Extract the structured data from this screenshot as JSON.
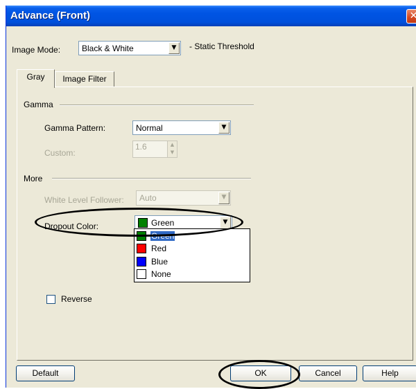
{
  "window": {
    "title": "Advance (Front)",
    "close_glyph": "✕"
  },
  "image_mode": {
    "label": "Image Mode:",
    "value": "Black & White",
    "note": "- Static Threshold"
  },
  "tabs": [
    {
      "label": "Gray"
    },
    {
      "label": "Image Filter"
    }
  ],
  "gamma": {
    "group_label": "Gamma",
    "pattern_label": "Gamma Pattern:",
    "pattern_value": "Normal",
    "custom_label": "Custom:",
    "custom_value": "1.6"
  },
  "more": {
    "group_label": "More",
    "white_level_label": "White Level Follower:",
    "white_level_value": "Auto",
    "dropout_label": "Dropout Color:",
    "dropout_value": "Green",
    "dropout_options": [
      {
        "label": "Green",
        "color": "#008000"
      },
      {
        "label": "Red",
        "color": "#FF0000"
      },
      {
        "label": "Blue",
        "color": "#0000FF"
      },
      {
        "label": "None",
        "color": "#FFFFFF"
      }
    ]
  },
  "reverse": {
    "label": "Reverse",
    "checked": false
  },
  "buttons": {
    "default": "Default",
    "ok": "OK",
    "cancel": "Cancel",
    "help": "Help"
  },
  "icons": {
    "dropdown_arrow": "▼",
    "spin_up": "▲",
    "spin_down": "▼"
  },
  "colors": {
    "title_bar": "#0054E3",
    "dialog_bg": "#ECE9D8",
    "selection": "#316AC5"
  }
}
